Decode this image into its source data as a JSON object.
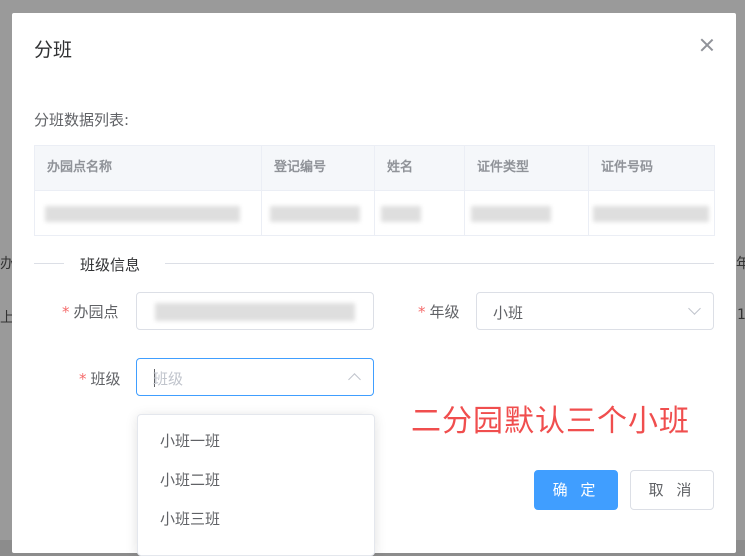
{
  "background": {
    "fragment_left_1": "办",
    "fragment_left_2": "上",
    "fragment_right_1": "年",
    "fragment_right_2": "1"
  },
  "dialog": {
    "title": "分班",
    "list_label": "分班数据列表:",
    "table": {
      "columns": [
        "办园点名称",
        "登记编号",
        "姓名",
        "证件类型",
        "证件号码"
      ]
    },
    "section_title": "班级信息",
    "form": {
      "required_mark": "*",
      "campus_label": "办园点",
      "campus_value": "",
      "grade_label": "年级",
      "grade_value": "小班",
      "class_label": "班级",
      "class_placeholder": "班级"
    },
    "class_options": [
      "小班一班",
      "小班二班",
      "小班三班"
    ],
    "annotation": "二分园默认三个小班",
    "confirm_label": "确 定",
    "cancel_label": "取 消"
  },
  "colors": {
    "primary": "#409eff",
    "required": "#f56c6c",
    "annotation": "#f04e4e"
  },
  "icons": [
    "close-icon",
    "chevron-down-icon",
    "chevron-up-icon"
  ]
}
